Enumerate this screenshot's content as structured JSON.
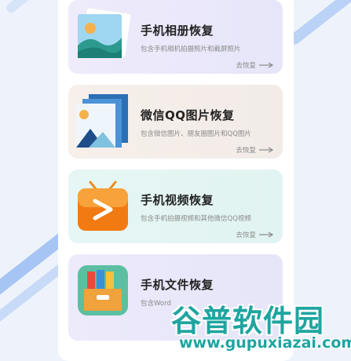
{
  "cards": [
    {
      "title": "手机相册恢复",
      "desc": "包含手机相机拍摄照片和截屏照片",
      "action": "去恢复",
      "icon": "photo-gallery-icon"
    },
    {
      "title": "微信QQ图片恢复",
      "desc": "包含微信图片、朋友圈图片和QQ图片",
      "action": "去恢复",
      "icon": "image-stack-icon"
    },
    {
      "title": "手机视频恢复",
      "desc": "包含手机拍摄视频和其他微信QQ视频",
      "action": "去恢复",
      "icon": "video-tv-icon"
    },
    {
      "title": "手机文件恢复",
      "desc": "包含Word",
      "action": "",
      "icon": "file-box-icon"
    }
  ],
  "watermark": {
    "name": "谷普软件园",
    "url": "www.gupuxiazai.com"
  },
  "colors": {
    "accent": "#1fa5a0",
    "arrow": "#8a8a8a"
  }
}
